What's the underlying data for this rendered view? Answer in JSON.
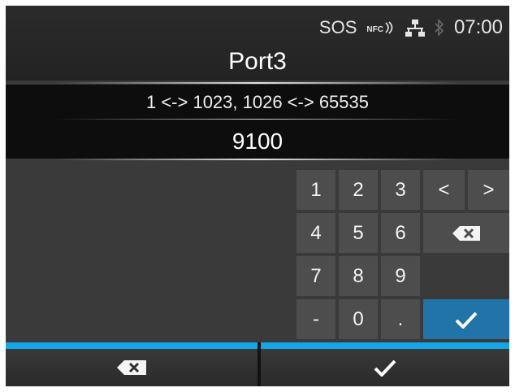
{
  "status_bar": {
    "sos": "SOS",
    "nfc": "NFC",
    "time": "07:00"
  },
  "screen": {
    "title": "Port3",
    "range": "1 <-> 1023, 1026 <-> 65535",
    "value": "9100"
  },
  "keypad": {
    "digit_keys": [
      "1",
      "2",
      "3",
      "4",
      "5",
      "6",
      "7",
      "8",
      "9",
      "-",
      "0",
      "."
    ],
    "left_label": "<",
    "right_label": ">"
  },
  "colors": {
    "accent": "#12a6e6",
    "confirm": "#2174a8"
  },
  "icons": {
    "backspace": "backspace-icon",
    "confirm": "checkmark-icon",
    "network": "network-icon",
    "bluetooth": "bluetooth-icon",
    "nfc": "nfc-icon"
  }
}
